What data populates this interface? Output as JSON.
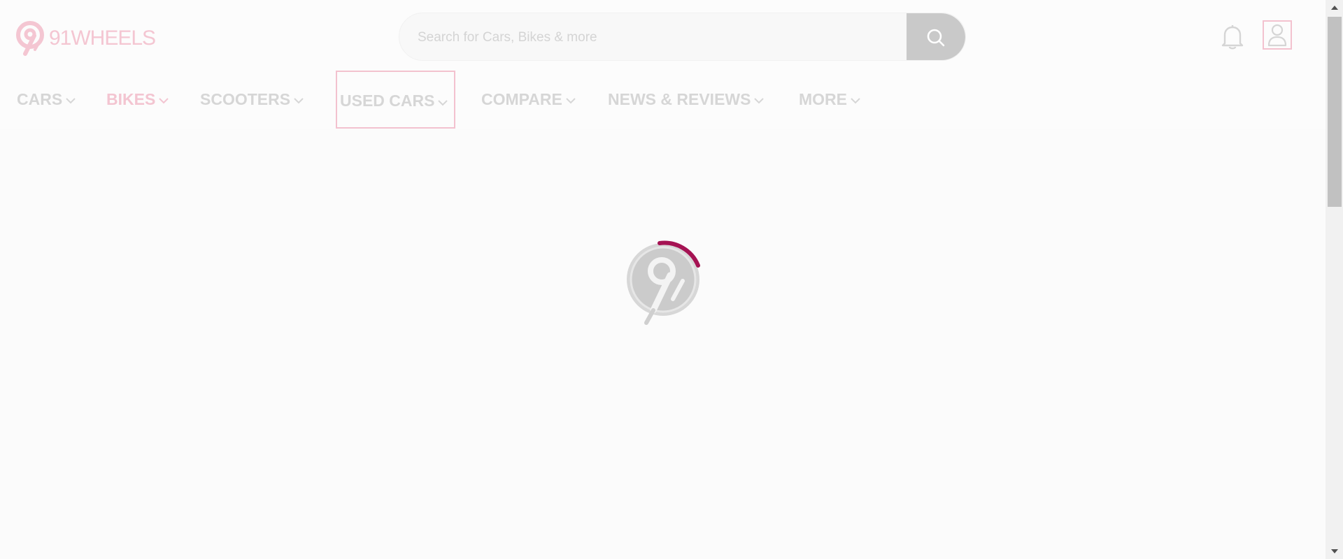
{
  "brand": {
    "logo_text": "91WHEELS",
    "color": "#f4c6d2",
    "accent": "#a51353"
  },
  "search": {
    "placeholder": "Search for Cars, Bikes & more",
    "button_icon": "search-icon"
  },
  "header_icons": {
    "notification": "bell-icon",
    "profile": "user-icon"
  },
  "nav": {
    "items": [
      {
        "label": "CARS",
        "icon": "chevron-down-icon"
      },
      {
        "label": "BIKES",
        "icon": "chevron-down-icon",
        "active": true
      },
      {
        "label": "SCOOTERS",
        "icon": "chevron-down-icon"
      },
      {
        "label": "USED CARS",
        "icon": "chevron-down-icon",
        "focused": true
      },
      {
        "label": "COMPARE",
        "icon": "chevron-down-icon"
      },
      {
        "label": "NEWS & REVIEWS",
        "icon": "chevron-down-icon"
      },
      {
        "label": "MORE",
        "icon": "chevron-down-icon"
      }
    ]
  },
  "loader": {
    "icon": "loading-spinner-icon",
    "color": "#a51353"
  }
}
